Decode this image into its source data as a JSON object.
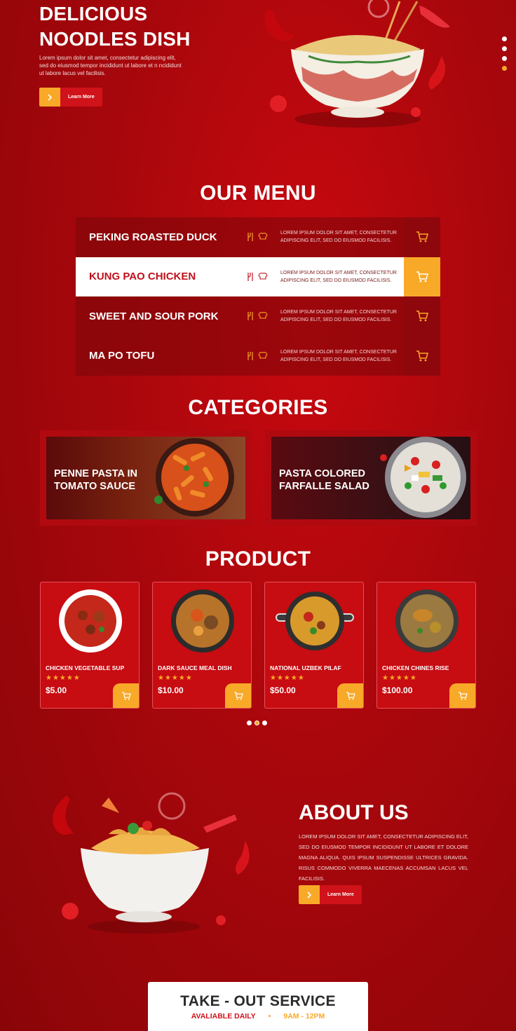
{
  "hero": {
    "title": "DELICIOUS NOODLES DISH",
    "description": "Lorem ipsum dolor sit amet, consectetur adipiscing elit, sed do eiusmod tempor incididunt ut labore et n ncididunt ut labore lacus vel facilisis.",
    "button_label": "Learn More"
  },
  "slider_dots": 4,
  "menu": {
    "title": "OUR MENU",
    "items": [
      {
        "name": "PEKING ROASTED DUCK",
        "desc": "LOREM IPSUM DOLOR SIT AMET, CONSECTETUR ADIPISCING ELIT, SED DO EIUSMOD FACILISIS."
      },
      {
        "name": "KUNG PAO CHICKEN",
        "desc": "LOREM IPSUM DOLOR SIT AMET, CONSECTETUR ADIPISCING ELIT, SED DO EIUSMOD FACILISIS."
      },
      {
        "name": "SWEET AND SOUR PORK",
        "desc": "LOREM IPSUM DOLOR SIT AMET, CONSECTETUR ADIPISCING ELIT, SED DO EIUSMOD FACILISIS."
      },
      {
        "name": "MA PO TOFU",
        "desc": "LOREM IPSUM DOLOR SIT AMET, CONSECTETUR ADIPISCING ELIT, SED DO EIUSMOD FACILISIS."
      }
    ]
  },
  "categories": {
    "title": "CATEGORIES",
    "items": [
      {
        "label": "PENNE PASTA IN TOMATO SAUCE"
      },
      {
        "label": "PASTA COLORED FARFALLE SALAD"
      }
    ]
  },
  "product": {
    "title": "PRODUCT",
    "items": [
      {
        "name": "CHICKEN VEGETABLE SUP",
        "price": "$5.00",
        "rating": 5
      },
      {
        "name": "DARK SAUCE MEAL DISH",
        "price": "$10.00",
        "rating": 5
      },
      {
        "name": "NATIONAL UZBEK PILAF",
        "price": "$50.00",
        "rating": 5
      },
      {
        "name": "CHICKEN CHINES RISE",
        "price": "$100.00",
        "rating": 5
      }
    ]
  },
  "about": {
    "title": "ABOUT US",
    "description": "LOREM IPSUM DOLOR SIT AMET, CONSECTETUR ADIPISCING ELIT, SED DO EIUSMOD TEMPOR INCIDIDUNT UT LABORE ET DOLORE MAGNA ALIQUA. QUIS IPSUM SUSPENDISSE ULTRICES GRAVIDA. RISUS COMMODO VIVERRA MAECENAS ACCUMSAN LACUS VEL FACILISIS.",
    "button_label": "Learn More"
  },
  "takeout": {
    "title": "TAKE - OUT SERVICE",
    "availability": "AVALIABLE DAILY",
    "hours": "9AM - 12PM"
  },
  "colors": {
    "accent": "#f9a928",
    "primary": "#c70c12",
    "dark": "#8a0508"
  }
}
